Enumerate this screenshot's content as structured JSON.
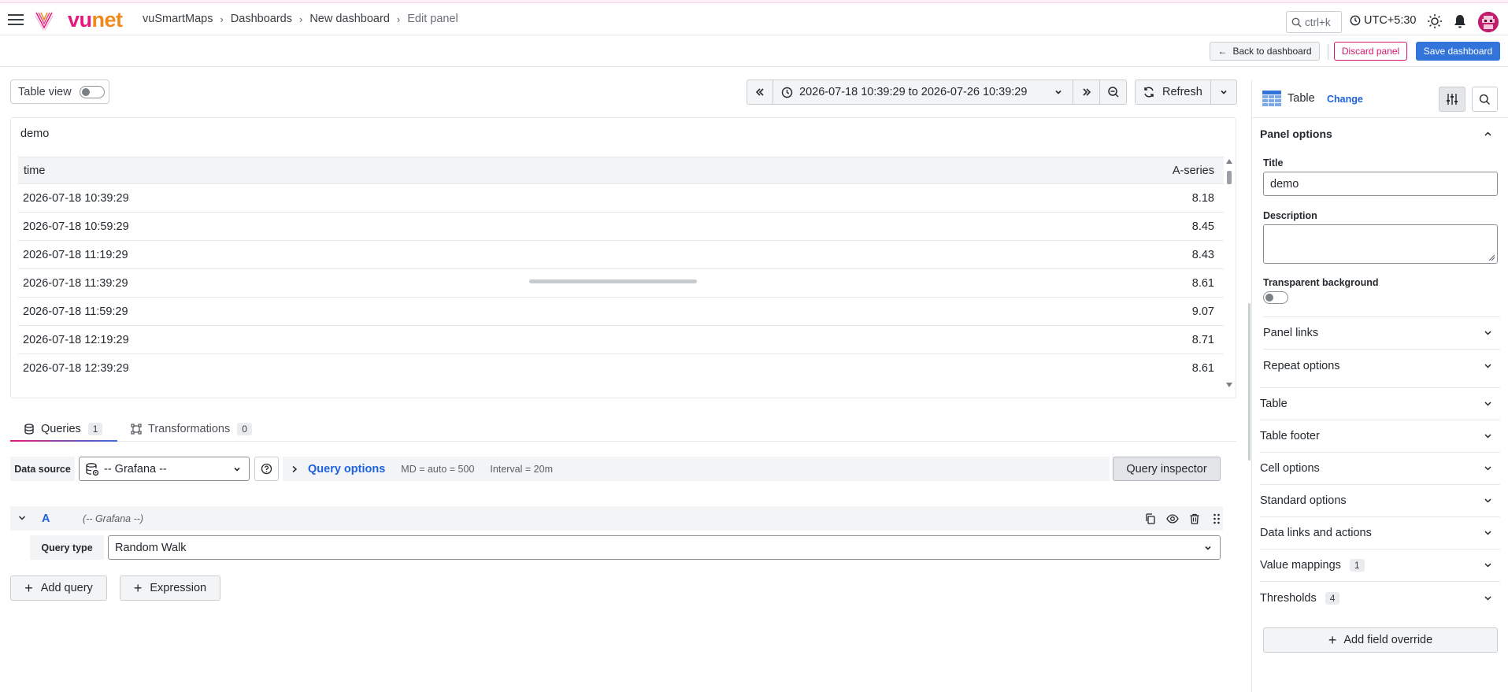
{
  "app": {
    "brand_vu": "vu",
    "brand_net": "net",
    "breadcrumbs": [
      "vuSmartMaps",
      "Dashboards",
      "New dashboard",
      "Edit panel"
    ],
    "search_placeholder": "ctrl+k",
    "timezone": "UTC+5:30",
    "colors": {
      "brand": "#e3197c",
      "accent": "#f08a1c",
      "primary": "#3274d9",
      "danger": "#d4176c"
    }
  },
  "actions": {
    "back": "Back to dashboard",
    "discard": "Discard panel",
    "save": "Save dashboard"
  },
  "toolbar": {
    "table_view": "Table view",
    "time_range": "2026-07-18 10:39:29 to 2026-07-26 10:39:29",
    "refresh": "Refresh"
  },
  "panel": {
    "title": "demo",
    "columns": [
      "time",
      "A-series"
    ],
    "rows": [
      [
        "2026-07-18 10:39:29",
        "8.18"
      ],
      [
        "2026-07-18 10:59:29",
        "8.45"
      ],
      [
        "2026-07-18 11:19:29",
        "8.43"
      ],
      [
        "2026-07-18 11:39:29",
        "8.61"
      ],
      [
        "2026-07-18 11:59:29",
        "9.07"
      ],
      [
        "2026-07-18 12:19:29",
        "8.71"
      ],
      [
        "2026-07-18 12:39:29",
        "8.61"
      ]
    ]
  },
  "tabs": [
    {
      "label": "Queries",
      "count": "1"
    },
    {
      "label": "Transformations",
      "count": "0"
    }
  ],
  "query": {
    "datasource_label": "Data source",
    "datasource": "-- Grafana --",
    "options_label": "Query options",
    "md": "MD = auto = 500",
    "interval": "Interval = 20m",
    "inspector": "Query inspector",
    "a_name": "A",
    "a_ds": "(-- Grafana --)",
    "type_label": "Query type",
    "type_value": "Random Walk",
    "add_query": "Add query",
    "expression": "Expression"
  },
  "options": {
    "viz_name": "Table",
    "change": "Change",
    "panel_options": "Panel options",
    "title_label": "Title",
    "title_value": "demo",
    "description_label": "Description",
    "transparent_label": "Transparent background",
    "panel_links": "Panel links",
    "repeat_options": "Repeat options",
    "sections": [
      {
        "label": "Table",
        "badge": ""
      },
      {
        "label": "Table footer",
        "badge": ""
      },
      {
        "label": "Cell options",
        "badge": ""
      },
      {
        "label": "Standard options",
        "badge": ""
      },
      {
        "label": "Data links and actions",
        "badge": ""
      },
      {
        "label": "Value mappings",
        "badge": "1"
      },
      {
        "label": "Thresholds",
        "badge": "4"
      }
    ],
    "add_override": "Add field override"
  }
}
